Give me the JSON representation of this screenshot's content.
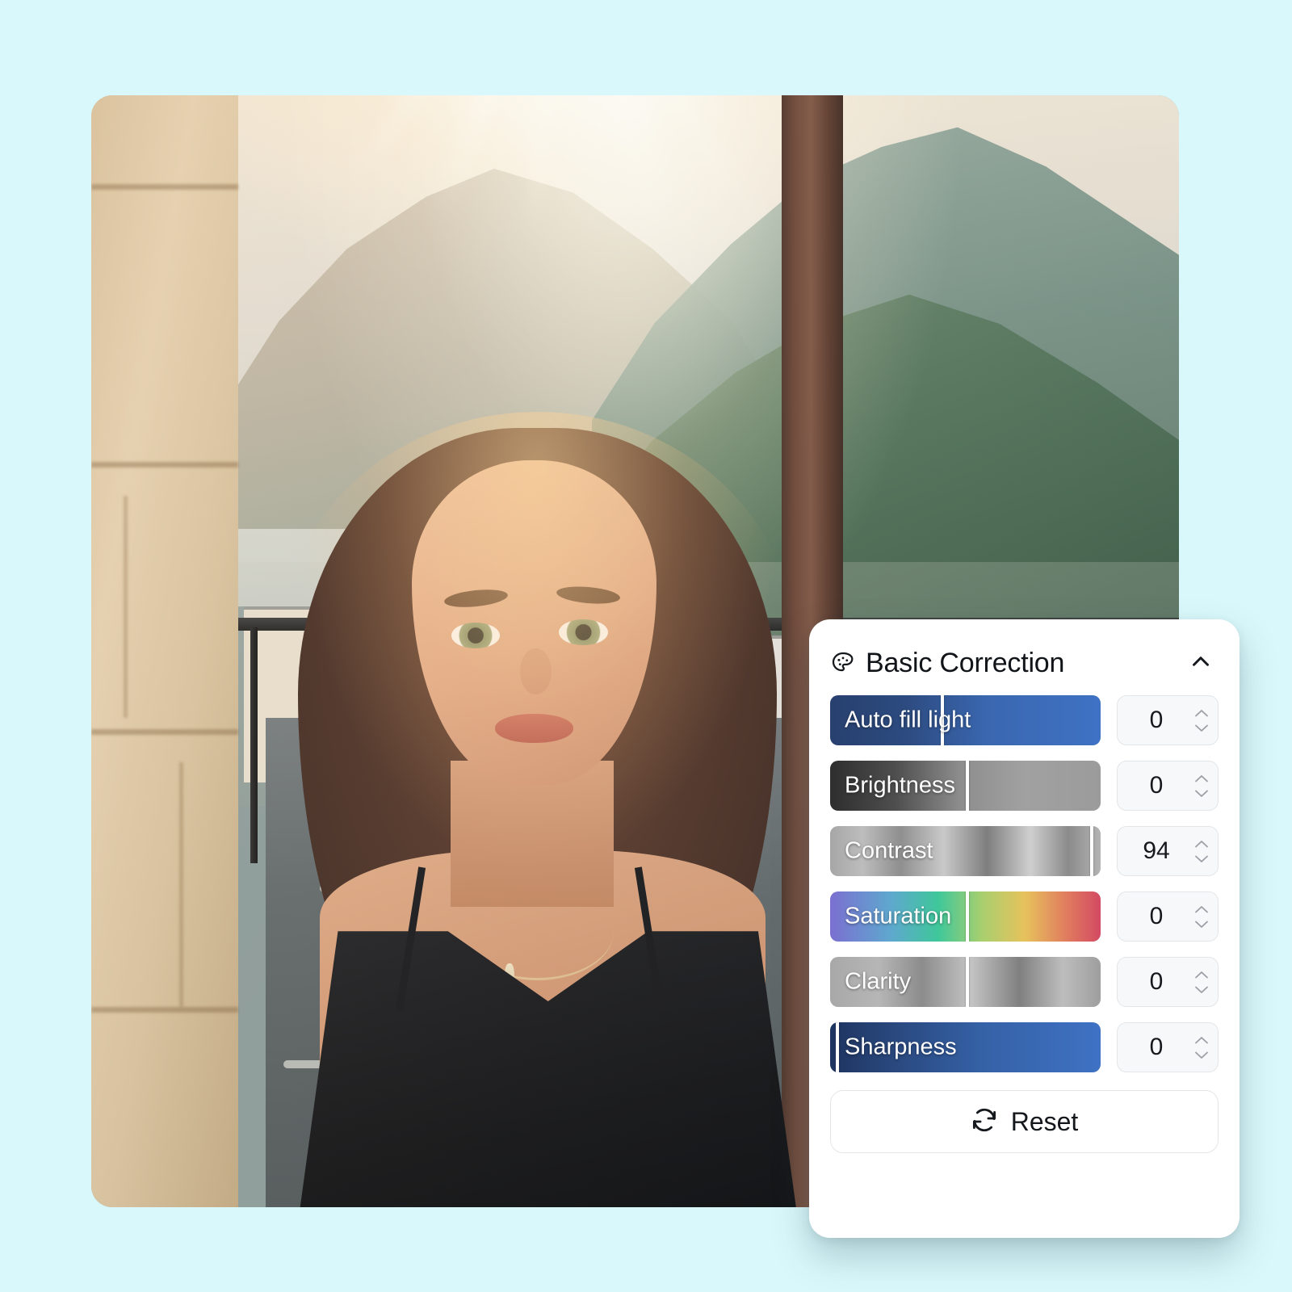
{
  "background_color": "#d9f8fb",
  "photo": {
    "alt_description": "Portrait of a woman on a balcony at sunset with a mountain village behind her",
    "corner_radius_px": 26
  },
  "panel": {
    "title": "Basic Correction",
    "title_icon": "palette-icon",
    "collapse_icon": "chevron-up-icon",
    "accent_color": "#3f72c4",
    "sliders": [
      {
        "label": "Auto fill light",
        "value": "0",
        "handle_percent": 41,
        "track": "blue",
        "stepper_icon": "stepper-updown-icon"
      },
      {
        "label": "Brightness",
        "value": "0",
        "handle_percent": 50,
        "track": "gray",
        "stepper_icon": "stepper-updown-icon"
      },
      {
        "label": "Contrast",
        "value": "94",
        "handle_percent": 96,
        "track": "metal",
        "stepper_icon": "stepper-updown-icon"
      },
      {
        "label": "Saturation",
        "value": "0",
        "handle_percent": 50,
        "track": "rainbow",
        "stepper_icon": "stepper-updown-icon"
      },
      {
        "label": "Clarity",
        "value": "0",
        "handle_percent": 50,
        "track": "clarity",
        "stepper_icon": "stepper-updown-icon"
      },
      {
        "label": "Sharpness",
        "value": "0",
        "handle_percent": 2,
        "track": "sharp",
        "stepper_icon": "stepper-updown-icon"
      }
    ],
    "reset": {
      "label": "Reset",
      "icon": "refresh-icon"
    }
  }
}
